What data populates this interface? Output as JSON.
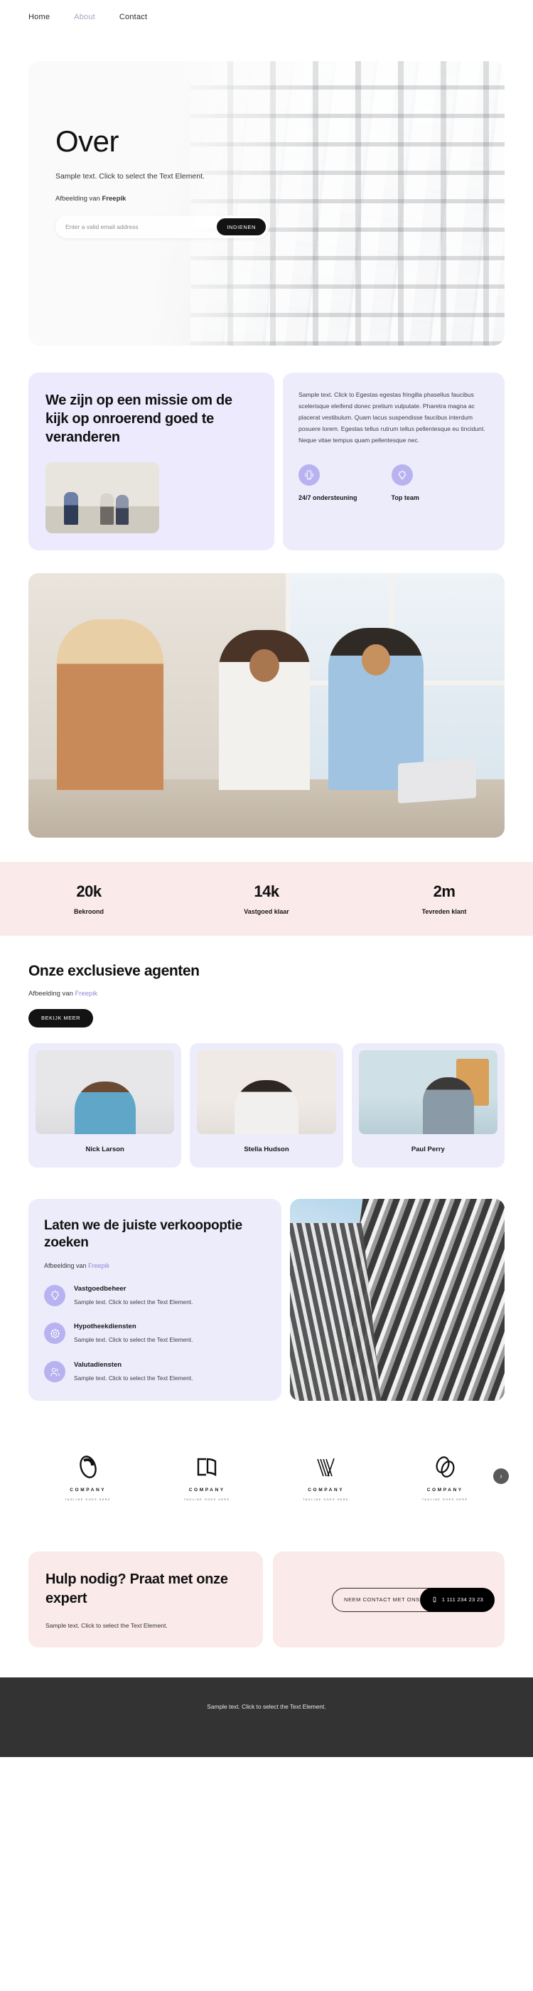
{
  "nav": {
    "items": [
      {
        "label": "Home",
        "active": true
      },
      {
        "label": "About",
        "active": false
      },
      {
        "label": "Contact",
        "active": false
      }
    ]
  },
  "hero": {
    "title": "Over",
    "subtitle": "Sample text. Click to select the Text Element.",
    "credit_prefix": "Afbeelding van ",
    "credit_source": "Freepik",
    "email_placeholder": "Enter a valid email address",
    "email_value": "",
    "submit_label": "INDIENEN"
  },
  "mission": {
    "title": "We zijn op een missie om de kijk op onroerend goed te veranderen",
    "body": "Sample text. Click to Egestas egestas fringilla phasellus faucibus scelerisque eleifend donec pretium vulputate. Pharetra magna ac placerat vestibulum. Quam lacus suspendisse faucibus interdum posuere lorem. Egestas tellus rutrum tellus pellentesque eu tincidunt. Neque vitae tempus quam pellentesque nec.",
    "features": [
      {
        "icon": "phone-icon",
        "label": "24/7 ondersteuning"
      },
      {
        "icon": "lightbulb-icon",
        "label": "Top team"
      }
    ]
  },
  "stats": [
    {
      "value": "20k",
      "label": "Bekroond"
    },
    {
      "value": "14k",
      "label": "Vastgoed klaar"
    },
    {
      "value": "2m",
      "label": "Tevreden klant"
    }
  ],
  "agents_section": {
    "title": "Onze exclusieve agenten",
    "credit_prefix": "Afbeelding van ",
    "credit_source": "Freepik",
    "button_label": "BEKIJK MEER",
    "agents": [
      {
        "name": "Nick Larson"
      },
      {
        "name": "Stella Hudson"
      },
      {
        "name": "Paul Perry"
      }
    ]
  },
  "sell_section": {
    "title": "Laten we de juiste verkoopoptie zoeken",
    "credit_prefix": "Afbeelding van ",
    "credit_source": "Freepik",
    "services": [
      {
        "icon": "lightbulb-icon",
        "title": "Vastgoedbeheer",
        "text": "Sample text. Click to select the Text Element."
      },
      {
        "icon": "gear-icon",
        "title": "Hypotheekdiensten",
        "text": "Sample text. Click to select the Text Element."
      },
      {
        "icon": "people-icon",
        "title": "Valutadiensten",
        "text": "Sample text. Click to select the Text Element."
      }
    ]
  },
  "logos": {
    "items": [
      {
        "mark": "ring-logo",
        "name": "COMPANY",
        "tagline": "TAGLINE GOES HERE"
      },
      {
        "mark": "book-logo",
        "name": "COMPANY",
        "tagline": "TAGLINE GOES HERE"
      },
      {
        "mark": "chevron-logo",
        "name": "COMPANY",
        "tagline": "TAGLINE GOES HERE"
      },
      {
        "mark": "overlap-logo",
        "name": "COMPANY",
        "tagline": "TAGLINE GOES HERE"
      }
    ],
    "next_label": "›"
  },
  "cta": {
    "title": "Hulp nodig? Praat met onze expert",
    "subtitle": "Sample text. Click to select the Text Element.",
    "contact_label": "NEEM CONTACT MET ONS OP",
    "phone_label": "1 111 234 23 23"
  },
  "footer": {
    "text": "Sample text. Click to select the Text Element."
  },
  "colors": {
    "lavender": "#edecfa",
    "lavender_icon": "#b9b2f0",
    "blush": "#fbeaea",
    "dark": "#131313",
    "footer": "#333333",
    "link": "#8e88d8"
  }
}
